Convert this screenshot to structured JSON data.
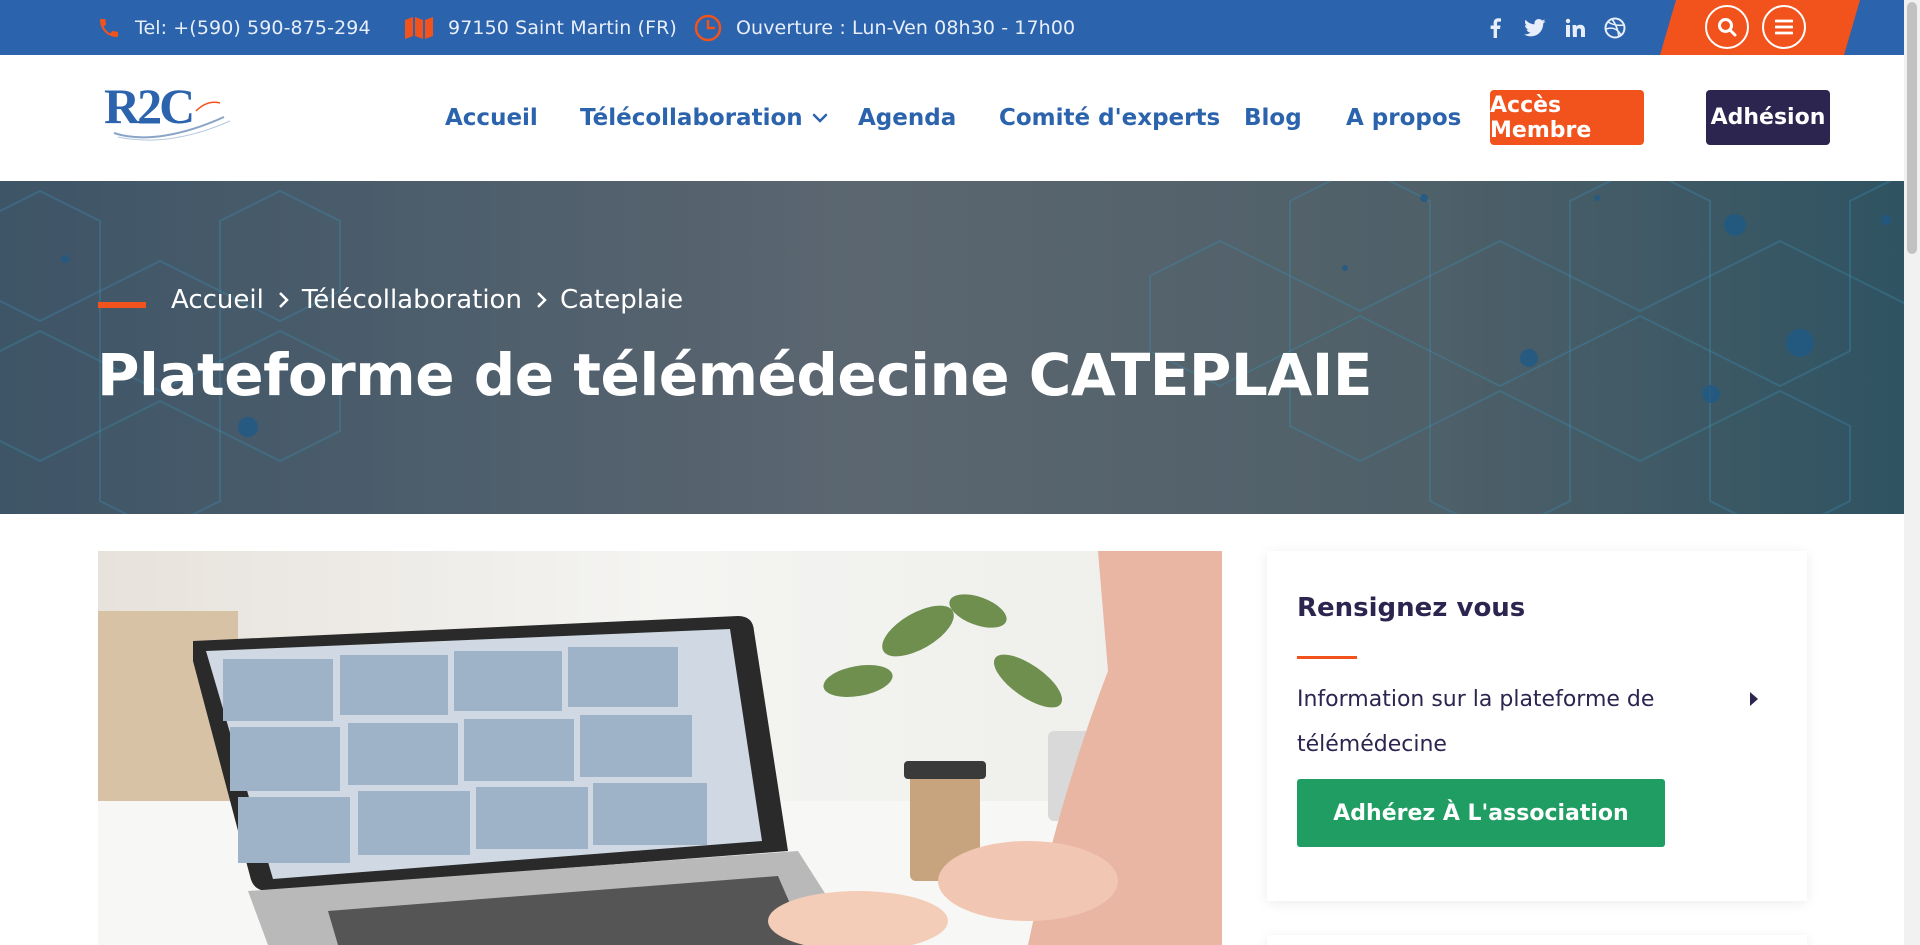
{
  "topbar": {
    "phone": "Tel: +(590) 590-875-294",
    "address": "97150 Saint Martin (FR)",
    "hours": "Ouverture : Lun-Ven 08h30 - 17h00",
    "social_icons": [
      "facebook-icon",
      "twitter-icon",
      "linkedin-icon",
      "dribbble-icon"
    ],
    "action_icons": [
      "search-icon",
      "menu-icon"
    ]
  },
  "header": {
    "logo_text": "R2C",
    "nav": [
      "Accueil",
      "Télécollaboration",
      "Agenda",
      "Comité d'experts",
      "Blog",
      "A propos"
    ],
    "member_button": "Accès Membre",
    "join_button": "Adhésion"
  },
  "hero": {
    "breadcrumb": [
      "Accueil",
      "Télécollaboration",
      "Cateplaie"
    ],
    "title": "Plateforme de télémédecine CATEPLAIE"
  },
  "sidebar": {
    "title": "Rensignez vous",
    "link": "Information sur la plateforme de télémédecine",
    "button": "Adhérez À L'association"
  },
  "colors": {
    "primary_blue": "#2b63ad",
    "accent_orange": "#f2531c",
    "dark_purple": "#2c2550",
    "green": "#1f9d62"
  }
}
